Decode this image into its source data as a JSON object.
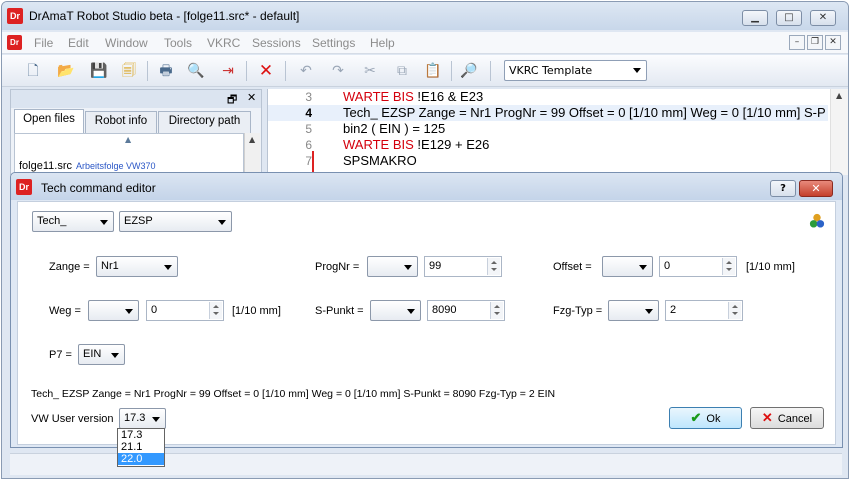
{
  "window": {
    "title": "DrAmaT Robot Studio beta - [folge11.src* - default]"
  },
  "menu": [
    "File",
    "Edit",
    "Window",
    "Tools",
    "VKRC",
    "Sessions",
    "Settings",
    "Help"
  ],
  "toolbar": {
    "template_select": "VKRC Template"
  },
  "left_panel": {
    "tabs": [
      "Open files",
      "Robot info",
      "Directory path"
    ],
    "active_tab": "Open files",
    "file": "folge11.src",
    "file_comment": "Arbeitsfolge VW370"
  },
  "code": {
    "lines": [
      {
        "num": "3",
        "parts": [
          {
            "t": "WARTE BIS",
            "kw": true
          },
          {
            "t": " !E16 & E23"
          }
        ]
      },
      {
        "num": "4",
        "parts": [
          {
            "t": "Tech_ EZSP Zange = Nr1 ProgNr = 99 Offset = 0 [1/10 mm] Weg = 0 [1/10 mm] S-P"
          }
        ]
      },
      {
        "num": "5",
        "parts": [
          {
            "t": "bin2 ( EIN ) = 125"
          }
        ]
      },
      {
        "num": "6",
        "parts": [
          {
            "t": "WARTE BIS",
            "kw": true
          },
          {
            "t": " !E129 + E26"
          }
        ]
      },
      {
        "num": "7",
        "parts": [
          {
            "t": "SPSMAKRO"
          }
        ]
      }
    ]
  },
  "dialog": {
    "title": "Tech command editor",
    "help_label": "?",
    "command": "Tech_",
    "subcommand": "EZSP",
    "zange_label": "Zange =",
    "zange_value": "Nr1",
    "prognr_label": "ProgNr =",
    "prognr_value": "99",
    "offset_label": "Offset =",
    "offset_value": "0",
    "offset_unit": "[1/10 mm]",
    "weg_label": "Weg =",
    "weg_value": "0",
    "weg_unit": "[1/10 mm]",
    "spunkt_label": "S-Punkt =",
    "spunkt_value": "8090",
    "fzgtyp_label": "Fzg-Typ =",
    "fzgtyp_value": "2",
    "p7_label": "P7 =",
    "p7_value": "EIN",
    "preview": "Tech_ EZSP Zange = Nr1 ProgNr = 99 Offset = 0 [1/10 mm] Weg = 0 [1/10 mm] S-Punkt = 8090 Fzg-Typ = 2 EIN",
    "version_label": "VW User version",
    "version_value": "17.3",
    "version_options": [
      "17.3",
      "21.1",
      "22.0"
    ],
    "version_highlight": "22.0",
    "ok_label": "Ok",
    "cancel_label": "Cancel"
  },
  "colors": {
    "keyword": "#d4000c",
    "selection": "#3399ff",
    "titlebar": "#c8d7ea"
  }
}
